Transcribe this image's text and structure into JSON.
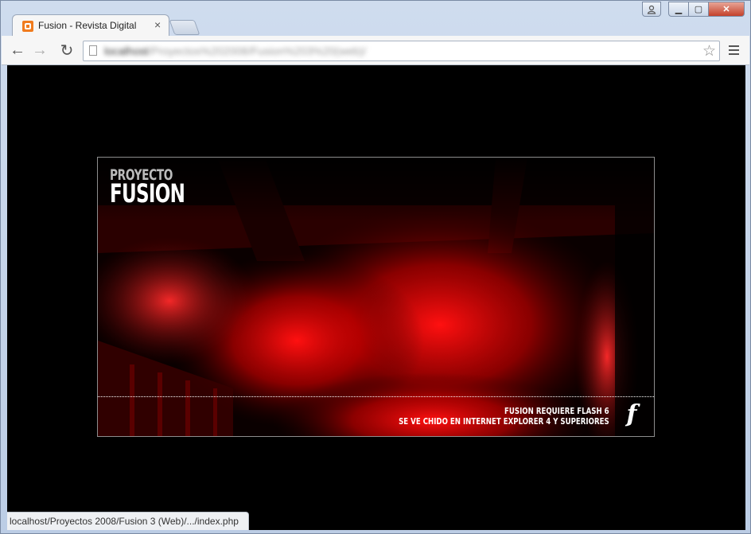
{
  "browser": {
    "tab_title": "Fusion - Revista Digital",
    "tab_close": "×",
    "url_host": "localhost",
    "url_path": "/Proyectos%202008/Fusion%203%20(web)/",
    "status_url": "localhost/Proyectos 2008/Fusion 3 (Web)/.../index.php"
  },
  "icons": {
    "favicon": "xampp-icon",
    "back": "back-arrow-icon",
    "forward": "forward-arrow-icon",
    "reload": "reload-icon",
    "star": "star-icon",
    "menu": "hamburger-menu-icon",
    "flash": "flash-player-icon"
  },
  "glyphs": {
    "back": "←",
    "forward": "→",
    "reload": "↻",
    "star": "☆",
    "min": "▁",
    "max": "▢",
    "close": "✕",
    "user": "👤",
    "flash": "f"
  },
  "flash_page": {
    "logo_top": "PROYECTO",
    "logo_bottom": "FUSION",
    "notice_line1": "FUSION REQUIERE FLASH 6",
    "notice_line2": "SE VE CHIDO EN INTERNET EXPLORER 4 Y SUPERIORES"
  },
  "colors": {
    "accent_red": "#e00000",
    "background": "#000000",
    "favicon_orange": "#f07b1e"
  }
}
